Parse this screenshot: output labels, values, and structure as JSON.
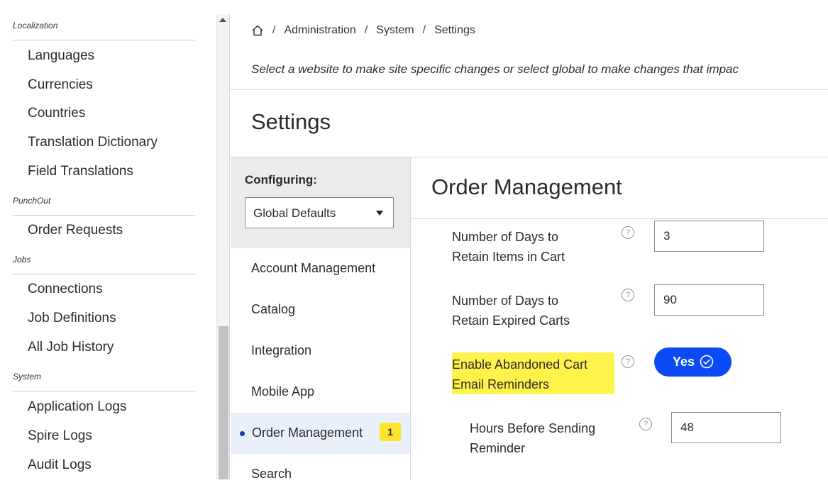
{
  "nav": {
    "sections": [
      {
        "title": "Localization",
        "items": [
          "Languages",
          "Currencies",
          "Countries",
          "Translation Dictionary",
          "Field Translations"
        ]
      },
      {
        "title": "PunchOut",
        "items": [
          "Order Requests"
        ]
      },
      {
        "title": "Jobs",
        "items": [
          "Connections",
          "Job Definitions",
          "All Job History"
        ]
      },
      {
        "title": "System",
        "items": [
          "Application Logs",
          "Spire Logs",
          "Audit Logs"
        ]
      }
    ]
  },
  "breadcrumb": {
    "home_icon": "home-icon",
    "items": [
      "Administration",
      "System",
      "Settings"
    ],
    "separator": "/"
  },
  "site_note": "Select a website to make site specific changes or select global to make changes that impac",
  "page_title": "Settings",
  "configuring": {
    "label": "Configuring:",
    "selected": "Global Defaults"
  },
  "menu": {
    "items": [
      "Account Management",
      "Catalog",
      "Integration",
      "Mobile App",
      "Order Management",
      "Search"
    ],
    "active_index": 4,
    "active_badge": "1"
  },
  "section": {
    "title": "Order Management",
    "fields": [
      {
        "label_line1": "Number of Days to",
        "label_line2": "Retain Items in Cart",
        "value": "3",
        "help": "?"
      },
      {
        "label_line1": "Number of Days to",
        "label_line2": "Retain Expired Carts",
        "value": "90",
        "help": "?"
      },
      {
        "label_line1": "Enable Abandoned Cart",
        "label_line2": "Email Reminders",
        "toggle": "Yes",
        "help": "?"
      },
      {
        "label_line1": "Hours Before Sending",
        "label_line2": "Reminder",
        "value": "48",
        "help": "?"
      }
    ]
  },
  "colors": {
    "toggle_on": "#0a4bf5",
    "highlight": "#fff24a",
    "badge": "#ffe52b",
    "active_menu_bg": "#eaf0fb"
  }
}
